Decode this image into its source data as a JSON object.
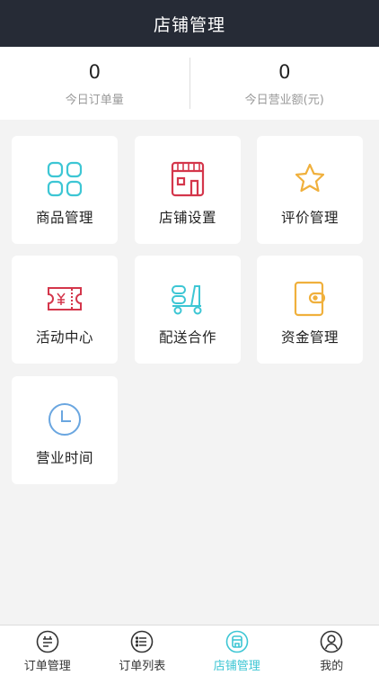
{
  "header": {
    "title": "店铺管理"
  },
  "stats": [
    {
      "value": "0",
      "label": "今日订单量"
    },
    {
      "value": "0",
      "label": "今日营业额(元)"
    }
  ],
  "menu": [
    {
      "label": "商品管理",
      "icon": "grid-icon",
      "color": "#3dc6d4"
    },
    {
      "label": "店铺设置",
      "icon": "store-icon",
      "color": "#d4364b"
    },
    {
      "label": "评价管理",
      "icon": "star-icon",
      "color": "#f0b03c"
    },
    {
      "label": "活动中心",
      "icon": "coupon-icon",
      "color": "#d4364b"
    },
    {
      "label": "配送合作",
      "icon": "delivery-icon",
      "color": "#3dc6d4"
    },
    {
      "label": "资金管理",
      "icon": "wallet-icon",
      "color": "#f0b03c"
    },
    {
      "label": "营业时间",
      "icon": "clock-icon",
      "color": "#6aa6e0"
    }
  ],
  "tabs": [
    {
      "label": "订单管理",
      "icon": "order-manage-icon",
      "active": false
    },
    {
      "label": "订单列表",
      "icon": "order-list-icon",
      "active": false
    },
    {
      "label": "店铺管理",
      "icon": "store-manage-icon",
      "active": true
    },
    {
      "label": "我的",
      "icon": "profile-icon",
      "active": false
    }
  ],
  "colors": {
    "header_bg": "#262b36",
    "accent": "#3dc6d4"
  }
}
